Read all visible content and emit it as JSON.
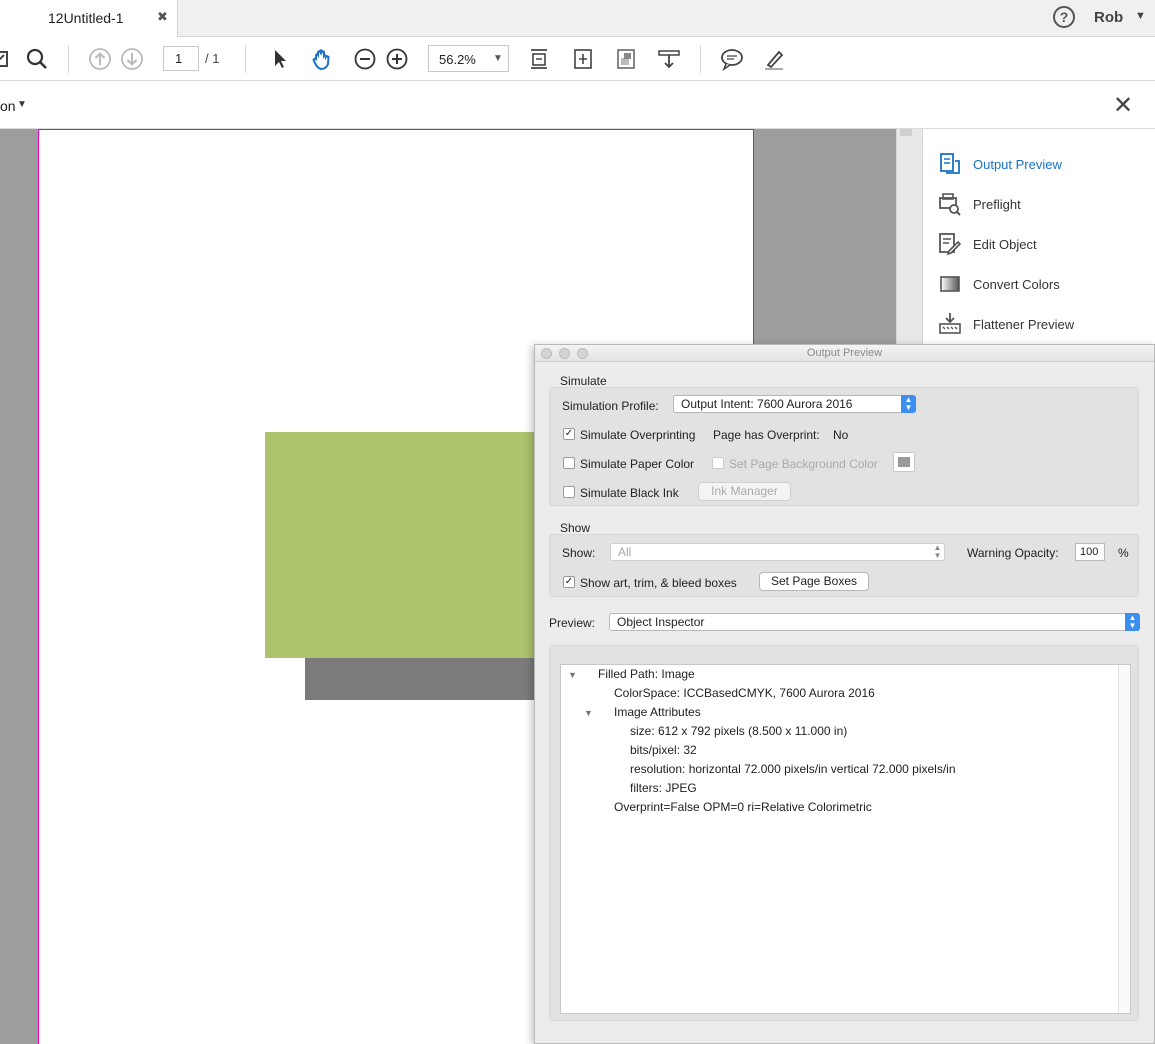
{
  "tab": {
    "title": "12Untitled-1",
    "close_glyph": "✖"
  },
  "user": {
    "name": "Rob",
    "help_icon": "?",
    "menu_caret": "▼"
  },
  "toolbar": {
    "page_current": "1",
    "page_total": "/ 1",
    "zoom": "56.2%",
    "zoom_caret": "▼"
  },
  "secondary_bar": {
    "label": "on",
    "caret": "▼",
    "close_glyph": "✕"
  },
  "tools_pane": {
    "items": [
      {
        "label": "Output Preview",
        "icon": "output-preview-icon",
        "active": true
      },
      {
        "label": "Preflight",
        "icon": "preflight-icon"
      },
      {
        "label": "Edit Object",
        "icon": "edit-object-icon"
      },
      {
        "label": "Convert Colors",
        "icon": "convert-colors-icon"
      },
      {
        "label": "Flattener Preview",
        "icon": "flattener-preview-icon"
      }
    ],
    "active_color": "#1a72c6"
  },
  "document": {
    "fill_color": "#adc46d",
    "shadow_color": "#7b7b7b",
    "page_border_color": "#e000e0"
  },
  "output_preview": {
    "title": "Output Preview",
    "simulate": {
      "section": "Simulate",
      "profile_label": "Simulation Profile:",
      "profile_value": "Output Intent: 7600 Aurora 2016",
      "overprinting_label": "Simulate Overprinting",
      "overprinting_checked": true,
      "page_overprint_label": "Page has Overprint:",
      "page_overprint_value": "No",
      "paper_color_label": "Simulate Paper Color",
      "paper_color_checked": false,
      "bg_color_label": "Set Page Background Color",
      "black_ink_label": "Simulate Black Ink",
      "black_ink_checked": false,
      "ink_manager_label": "Ink Manager"
    },
    "show": {
      "section": "Show",
      "show_label": "Show:",
      "show_value": "All",
      "warning_opacity_label": "Warning Opacity:",
      "warning_opacity_value": "100",
      "percent": "%",
      "boxes_label": "Show art, trim, & bleed boxes",
      "boxes_checked": true,
      "set_page_boxes_label": "Set Page Boxes"
    },
    "preview": {
      "label": "Preview:",
      "value": "Object Inspector"
    },
    "inspector": {
      "filled_path": "Filled Path: Image",
      "colorspace": "ColorSpace: ICCBasedCMYK, 7600 Aurora 2016",
      "image_attributes": "Image Attributes",
      "size": "size: 612 x 792 pixels (8.500 x 11.000 in)",
      "bits": "bits/pixel: 32",
      "resolution": "resolution: horizontal 72.000 pixels/in vertical 72.000 pixels/in",
      "filters": "filters: JPEG",
      "overprint": "Overprint=False OPM=0 ri=Relative Colorimetric"
    }
  }
}
